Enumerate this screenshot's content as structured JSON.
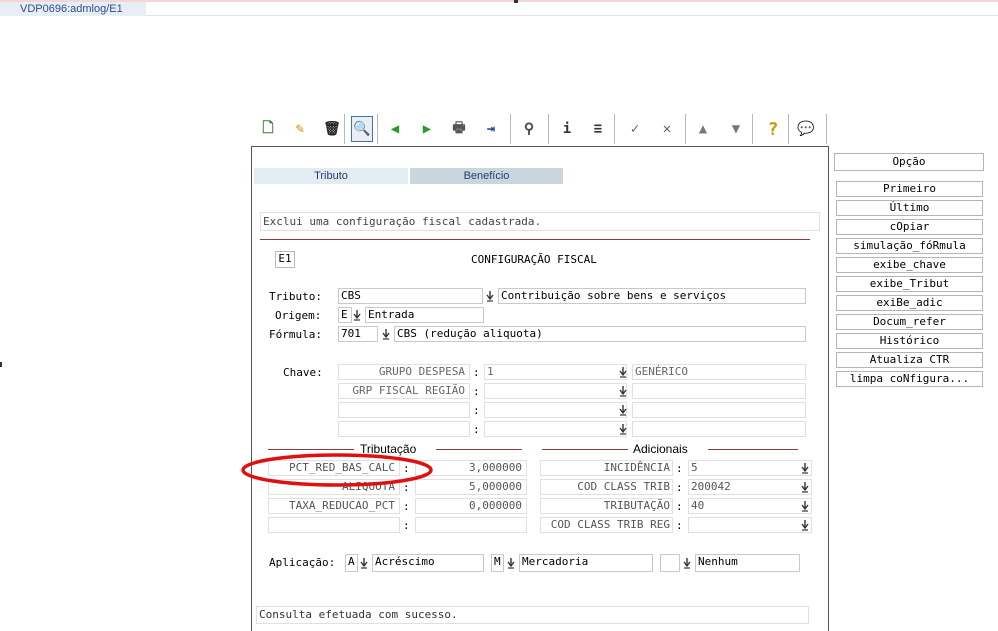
{
  "window": {
    "tab_title": "VDP0696:admlog/E1"
  },
  "toolbar": {
    "items": [
      {
        "icon": "new-document-icon",
        "glyph": "🗋"
      },
      {
        "icon": "edit-icon",
        "glyph": "✎"
      },
      {
        "icon": "delete-trash-icon",
        "glyph": "🗑"
      },
      {
        "icon": "search-magnifier-icon",
        "glyph": "🔍"
      },
      {
        "icon": "previous-arrow-icon",
        "glyph": "◀"
      },
      {
        "icon": "next-arrow-icon",
        "glyph": "▶"
      },
      {
        "icon": "print-icon",
        "glyph": "🖶"
      },
      {
        "icon": "exit-door-icon",
        "glyph": "⇥"
      },
      {
        "icon": "binoculars-icon",
        "glyph": "⚲"
      },
      {
        "icon": "info-icon",
        "glyph": "i"
      },
      {
        "icon": "list-icon",
        "glyph": "≡"
      },
      {
        "icon": "confirm-check-icon",
        "glyph": "✓"
      },
      {
        "icon": "cancel-x-icon",
        "glyph": "✕"
      },
      {
        "icon": "page-up-icon",
        "glyph": "▲"
      },
      {
        "icon": "page-down-icon",
        "glyph": "▼"
      },
      {
        "icon": "help-question-icon",
        "glyph": "?"
      },
      {
        "icon": "comment-bubble-icon",
        "glyph": "💬"
      }
    ]
  },
  "tabs": {
    "tab1": "Tributo",
    "tab2": "Benefício"
  },
  "message_top": "Exclui uma configuração fiscal cadastrada.",
  "header": {
    "code": "E1",
    "title": "CONFIGURAÇÃO FISCAL"
  },
  "form": {
    "tributo_label": "Tributo:",
    "tributo_value": "CBS",
    "tributo_desc": "Contribuição sobre bens e serviços",
    "origem_label": "Origem:",
    "origem_value": "E",
    "origem_desc": "Entrada",
    "formula_label": "Fórmula:",
    "formula_value": "701",
    "formula_desc": "CBS (redução aliquota)",
    "chave_label": "Chave:",
    "chave_rows": [
      {
        "name": "GRUPO DESPESA",
        "value": "1",
        "desc": "GENÉRICO"
      },
      {
        "name": "GRP FISCAL REGIÃO",
        "value": "",
        "desc": ""
      },
      {
        "name": "",
        "value": "",
        "desc": ""
      },
      {
        "name": "",
        "value": "",
        "desc": ""
      }
    ],
    "colon": ":"
  },
  "tributacao": {
    "title": "Tributação",
    "rows": [
      {
        "name": "PCT_RED_BAS_CALC",
        "value": "3,000000"
      },
      {
        "name": "ALIQUOTA",
        "value": "5,000000"
      },
      {
        "name": "TAXA_REDUCAO_PCT",
        "value": "0,000000"
      },
      {
        "name": "",
        "value": ""
      }
    ]
  },
  "adicionais": {
    "title": "Adicionais",
    "rows": [
      {
        "name": "INCIDÊNCIA",
        "value": "5"
      },
      {
        "name": "COD CLASS TRIB",
        "value": "200042"
      },
      {
        "name": "TRIBUTAÇÃO",
        "value": "40"
      },
      {
        "name": "COD CLASS TRIB REG",
        "value": ""
      }
    ]
  },
  "aplicacao": {
    "label": "Aplicação:",
    "a_code": "A",
    "a_desc": "Acréscimo",
    "m_code": "M",
    "m_desc": "Mercadoria",
    "n_code": "",
    "n_desc": "Nenhum"
  },
  "status_message": "Consulta efetuada com sucesso.",
  "side_menu": {
    "title": "Opção",
    "buttons": [
      "Primeiro",
      "Último",
      "cOpiar",
      "simulação_fóRmula",
      "exibe_chave",
      "exibe_Tribut",
      "exiBe_adic",
      "Docum_refer",
      "Histórico",
      "Atualiza CTR",
      "limpa coNfigura..."
    ]
  },
  "colors": {
    "highlight_circle": "#e01010",
    "tab_active": "#e3ecf3",
    "tab_inactive": "#c9d6de"
  }
}
